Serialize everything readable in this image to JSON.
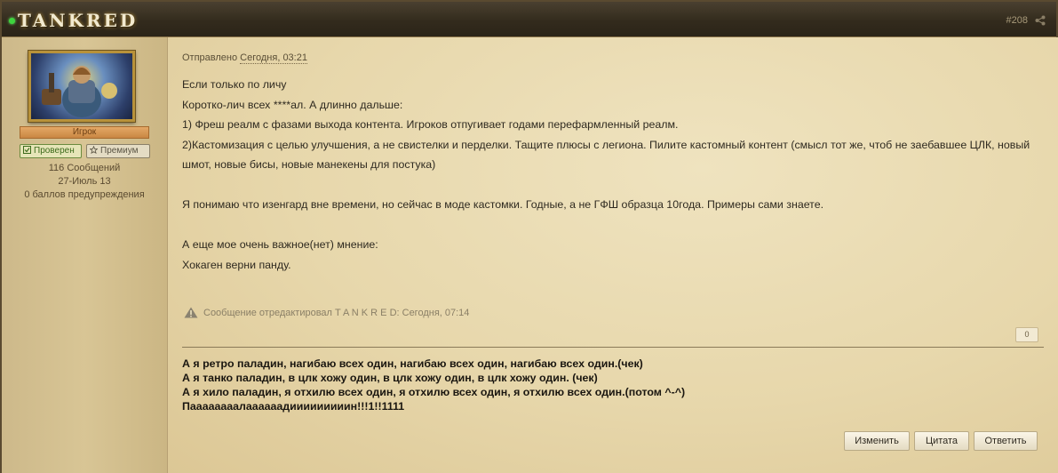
{
  "header": {
    "username": "TANKRED",
    "post_number": "#208"
  },
  "sidebar": {
    "rank": "Игрок",
    "badges": {
      "verified": "Проверен",
      "premium": "Премиум"
    },
    "stats": [
      "116 Сообщений",
      "27-Июль 13",
      "0 баллов предупреждения"
    ]
  },
  "post": {
    "meta_prefix": "Отправлено",
    "meta_date": "Сегодня, 03:21",
    "lines": [
      "Если только по личу",
      "Коротко-лич всех ****ал. А длинно дальше:",
      "1) Фреш реалм с фазами выхода контента. Игроков отпугивает годами перефармленный реалм.",
      "2)Кастомизация с целью улучшения, а не свистелки и перделки. Тащите плюсы с легиона. Пилите кастомный контент (смысл тот же, чтоб не заебавшее ЦЛК, новый шмот, новые бисы, новые манекены для постука)",
      "Я понимаю что изенгард вне времени, но сейчас в моде кастомки. Годные, а не ГФШ образца 10года. Примеры сами знаете.",
      "А еще мое очень важное(нет) мнение:",
      "Хокаген верни панду."
    ],
    "edit_note": "Сообщение отредактировал T A N K R E D: Сегодня, 07:14",
    "reputation": "0",
    "signature": [
      "А я ретро паладин, нагибаю всех один, нагибаю всех один, нагибаю всех один.(чек)",
      "А я танко паладин, в цлк хожу один, в цлк хожу один, в цлк хожу один. (чек)",
      "А я хило паладин, я отхилю всех один, я отхилю всех один, я отхилю всех один.(потом ^-^)",
      "Паааааааалаааааадииииииииин!!!1!!1111"
    ],
    "buttons": {
      "edit": "Изменить",
      "quote": "Цитата",
      "reply": "Ответить"
    }
  },
  "icons": {
    "online": "online-status-dot",
    "share": "share-icon",
    "verified": "checkbox-icon",
    "premium": "star-icon",
    "edit_note": "warning-icon"
  },
  "colors": {
    "header_bg": "#332b1d",
    "content_bg": "#e8d9b0",
    "online": "#3ed43e",
    "rank_bg": "#d99a55"
  }
}
